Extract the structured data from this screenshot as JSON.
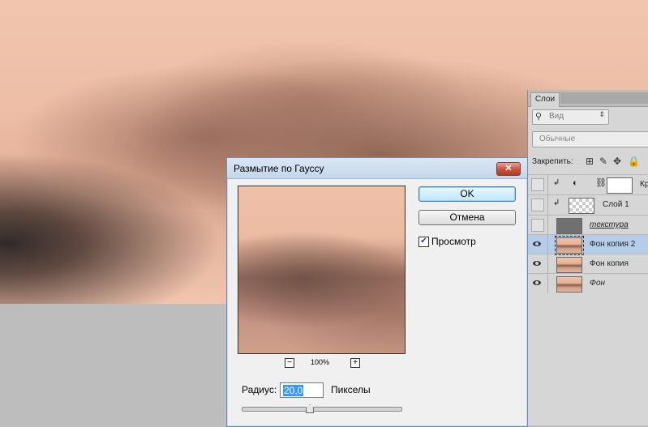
{
  "layers_panel": {
    "tab_label": "Слои",
    "search_placeholder": "Вид",
    "blend_mode": "Обычные",
    "lock_label": "Закрепить:",
    "adjust_label": "Кр",
    "layers": [
      {
        "name": "Слой 1",
        "visible": false,
        "thumb": "check",
        "clipped": true,
        "adjustment": false
      },
      {
        "name": "текстура",
        "visible": false,
        "thumb": "gray",
        "underlined": true
      },
      {
        "name": "Фон копия 2",
        "visible": true,
        "thumb": "face",
        "selected": true
      },
      {
        "name": "Фон копия",
        "visible": true,
        "thumb": "face"
      },
      {
        "name": "Фон",
        "visible": true,
        "thumb": "face",
        "italic": true
      }
    ]
  },
  "dialog": {
    "title": "Размытие по Гауссу",
    "close_label": "✕",
    "ok_label": "OK",
    "cancel_label": "Отмена",
    "preview_label": "Просмотр",
    "preview_checked": true,
    "zoom_value": "100%",
    "zoom_minus": "−",
    "zoom_plus": "+",
    "radius_label": "Радиус:",
    "radius_value": "20,0",
    "radius_unit": "Пикселы",
    "slider_fraction": 0.42
  }
}
